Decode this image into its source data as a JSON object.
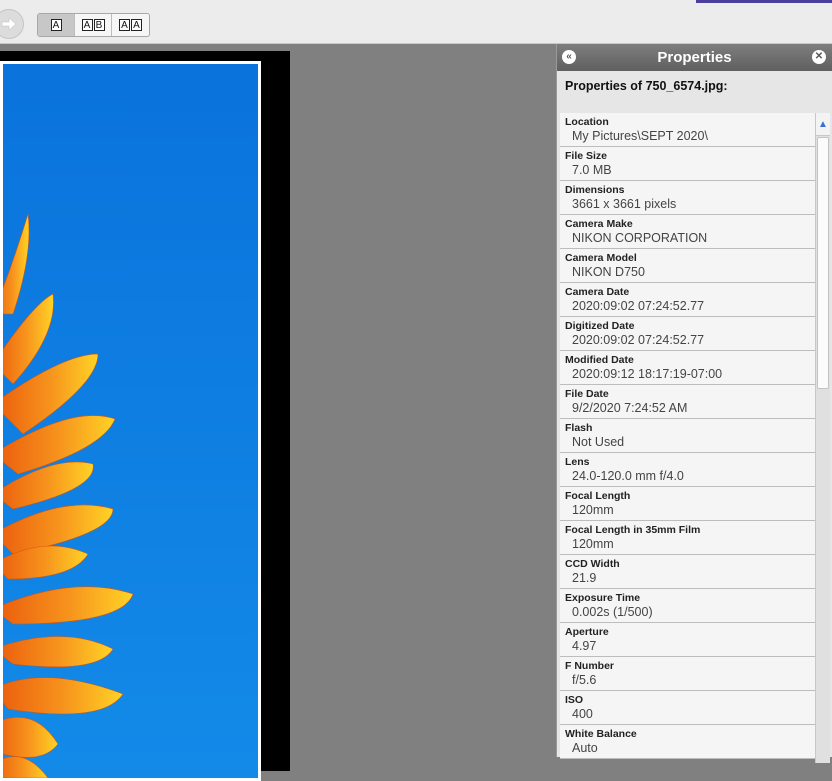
{
  "toolbar": {
    "forward_icon": "arrow-right-icon",
    "layouts": [
      {
        "letters": [
          "A"
        ]
      },
      {
        "letters": [
          "A",
          "B"
        ]
      },
      {
        "letters": [
          "A",
          "A"
        ]
      }
    ]
  },
  "panel": {
    "title": "Properties",
    "collapse_icon": "double-chevron-left-icon",
    "close_icon": "close-icon",
    "subheader": "Properties of 750_6574.jpg:",
    "properties": [
      {
        "label": "Location",
        "value": "My Pictures\\SEPT 2020\\"
      },
      {
        "label": "File Size",
        "value": "7.0 MB"
      },
      {
        "label": "Dimensions",
        "value": "3661 x 3661 pixels"
      },
      {
        "label": "Camera Make",
        "value": "NIKON CORPORATION"
      },
      {
        "label": "Camera Model",
        "value": "NIKON D750"
      },
      {
        "label": "Camera Date",
        "value": "2020:09:02 07:24:52.77"
      },
      {
        "label": "Digitized Date",
        "value": "2020:09:02 07:24:52.77"
      },
      {
        "label": "Modified Date",
        "value": "2020:09:12 18:17:19-07:00"
      },
      {
        "label": "File Date",
        "value": "9/2/2020 7:24:52 AM"
      },
      {
        "label": "Flash",
        "value": "Not Used"
      },
      {
        "label": "Lens",
        "value": "24.0-120.0 mm f/4.0"
      },
      {
        "label": "Focal Length",
        "value": "120mm"
      },
      {
        "label": "Focal Length in 35mm Film",
        "value": "120mm"
      },
      {
        "label": "CCD Width",
        "value": "21.9"
      },
      {
        "label": "Exposure Time",
        "value": "0.002s (1/500)"
      },
      {
        "label": "Aperture",
        "value": "4.97"
      },
      {
        "label": "F Number",
        "value": "f/5.6"
      },
      {
        "label": "ISO",
        "value": "400"
      },
      {
        "label": "White Balance",
        "value": "Auto"
      }
    ]
  },
  "colors": {
    "accent": "#4b3f9e",
    "sky": "#0a7fe0",
    "petal_orange": "#f07a10",
    "petal_yellow": "#ffd21a"
  }
}
